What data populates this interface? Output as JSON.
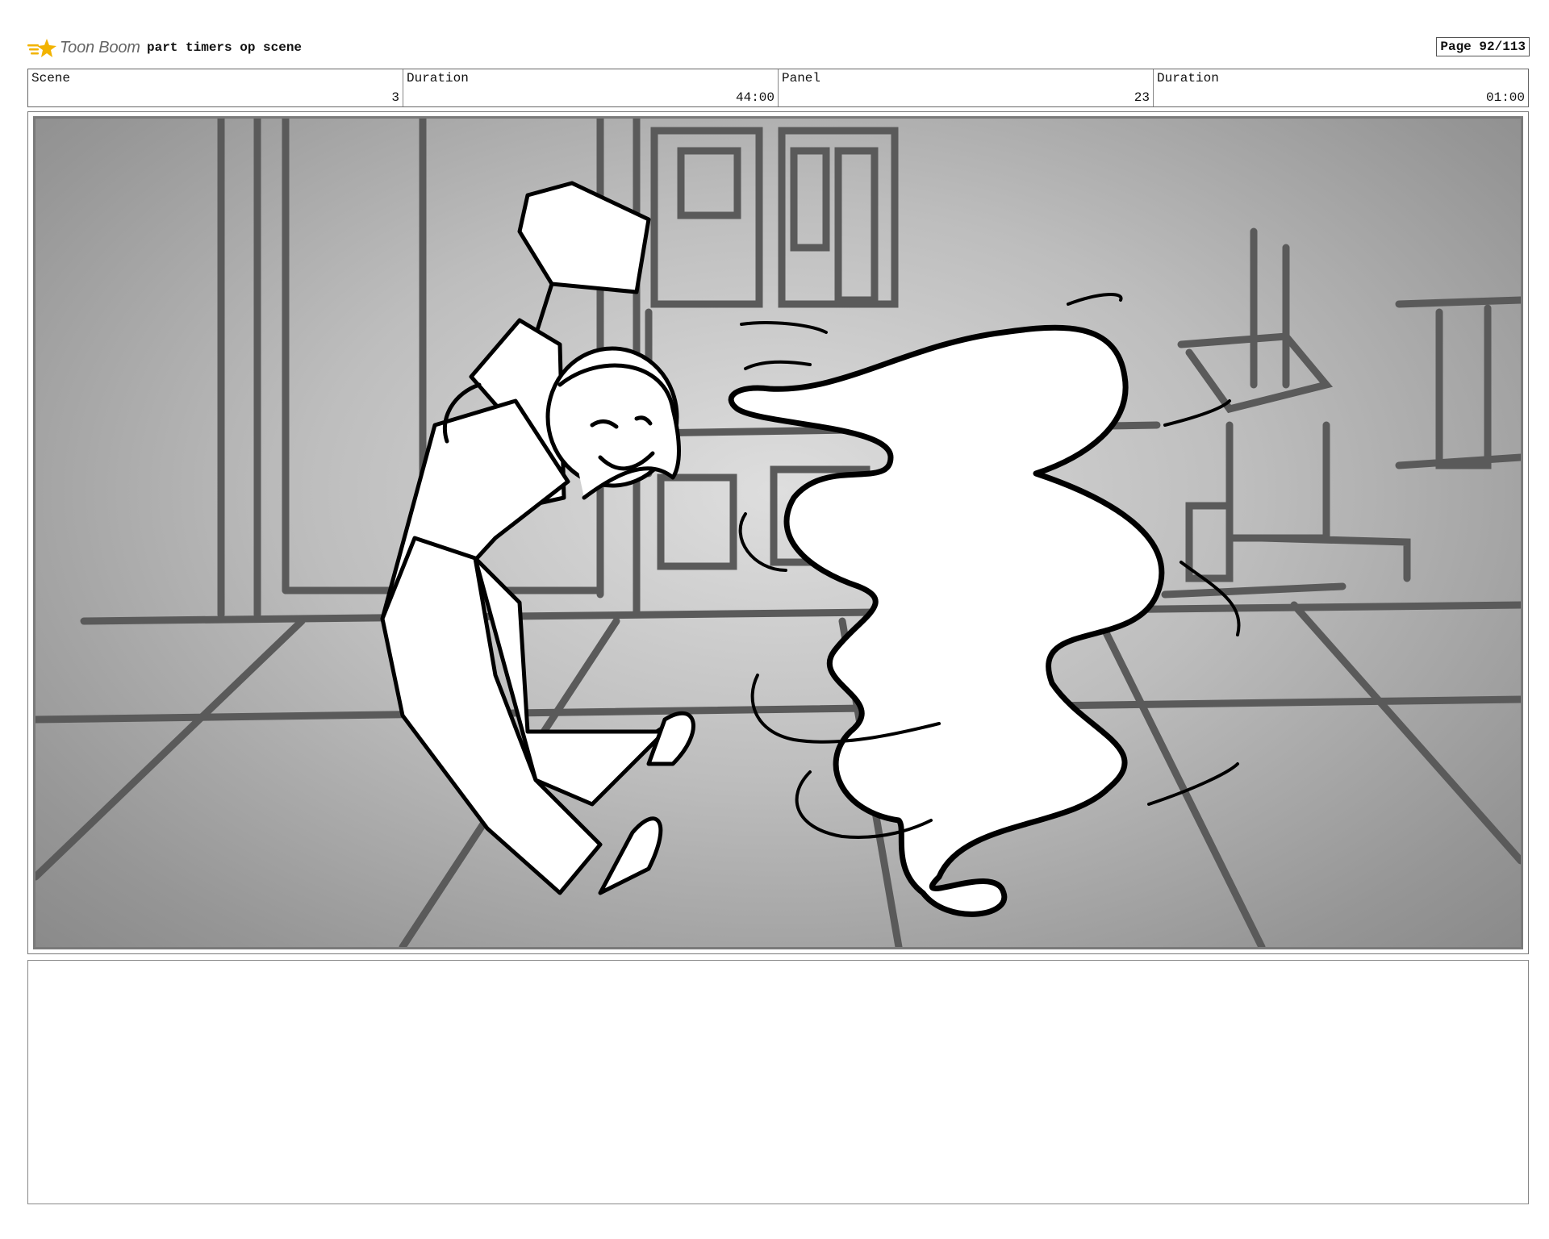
{
  "header": {
    "logo_text": "Toon Boom",
    "logo_icon": "toon-boom-star-icon",
    "project_title": "part timers op scene",
    "page_label": "Page  92/113"
  },
  "info": [
    {
      "label": "Scene",
      "value": "3"
    },
    {
      "label": "Duration",
      "value": "44:00"
    },
    {
      "label": "Panel",
      "value": "23"
    },
    {
      "label": "Duration",
      "value": "01:00"
    }
  ],
  "colors": {
    "logo_accent": "#f2b300",
    "sketch_line": "#000000",
    "background_lines": "#5a5a5a"
  },
  "notes": {
    "text": ""
  }
}
